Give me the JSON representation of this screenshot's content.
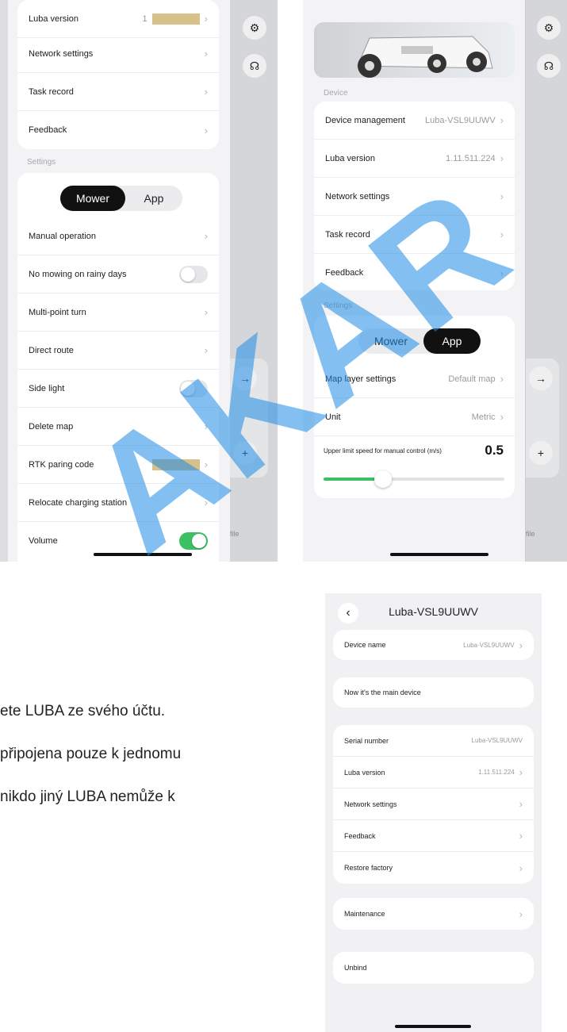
{
  "left_phone": {
    "top_card": [
      {
        "label": "Luba version",
        "value": "1"
      },
      {
        "label": "Network settings",
        "value": ""
      },
      {
        "label": "Task record",
        "value": ""
      },
      {
        "label": "Feedback",
        "value": ""
      }
    ],
    "settings_label": "Settings",
    "segment": {
      "mower": "Mower",
      "app": "App",
      "active": "Mower"
    },
    "rows": [
      {
        "label": "Manual operation",
        "type": "chevron"
      },
      {
        "label": "No mowing on rainy days",
        "type": "toggle",
        "on": false
      },
      {
        "label": "Multi-point turn",
        "type": "chevron"
      },
      {
        "label": "Direct route",
        "type": "chevron"
      },
      {
        "label": "Side light",
        "type": "toggle",
        "on": false
      },
      {
        "label": "Delete map",
        "type": "chevron"
      },
      {
        "label": "RTK paring code",
        "type": "chevron"
      },
      {
        "label": "Relocate charging station",
        "type": "chevron"
      },
      {
        "label": "Volume",
        "type": "toggle",
        "on": true
      }
    ]
  },
  "right_phone": {
    "device_label": "Device",
    "device_rows": [
      {
        "label": "Device management",
        "value": "Luba-VSL9UUWV"
      },
      {
        "label": "Luba version",
        "value": "1.11.511.224"
      },
      {
        "label": "Network settings",
        "value": ""
      },
      {
        "label": "Task record",
        "value": ""
      },
      {
        "label": "Feedback",
        "value": ""
      }
    ],
    "settings_label": "Settings",
    "segment": {
      "mower": "Mower",
      "app": "App",
      "active": "App"
    },
    "settings_rows": [
      {
        "label": "Map layer settings",
        "value": "Default map"
      },
      {
        "label": "Unit",
        "value": "Metric"
      }
    ],
    "speed": {
      "label": "Upper limit speed for manual control (m/s)",
      "value": "0.5",
      "fraction": 0.33
    }
  },
  "side_strip": {
    "profile_text": "file"
  },
  "detail_screen": {
    "title": "Luba-VSL9UUWV",
    "device_name": {
      "label": "Device name",
      "value": "Luba-VSL9UUWV"
    },
    "main_device": "Now it's the main device",
    "info_rows": [
      {
        "label": "Serial number",
        "value": "Luba-VSL9UUWV",
        "chevron": false
      },
      {
        "label": "Luba version",
        "value": "1.11.511.224",
        "chevron": true
      },
      {
        "label": "Network settings",
        "value": "",
        "chevron": true
      },
      {
        "label": "Feedback",
        "value": "",
        "chevron": true
      },
      {
        "label": "Restore factory",
        "value": "",
        "chevron": true
      }
    ],
    "maintenance": "Maintenance",
    "unbind": "Unbind"
  },
  "document_text": [
    "ete LUBA ze svého účtu.",
    "připojena pouze k jednomu",
    "nikdo jiný LUBA nemůže k"
  ],
  "watermark": "AKAR",
  "colors": {
    "toggle_on": "#3cc063",
    "slider": "#3cc063",
    "watermark": "#1e8ce6"
  }
}
